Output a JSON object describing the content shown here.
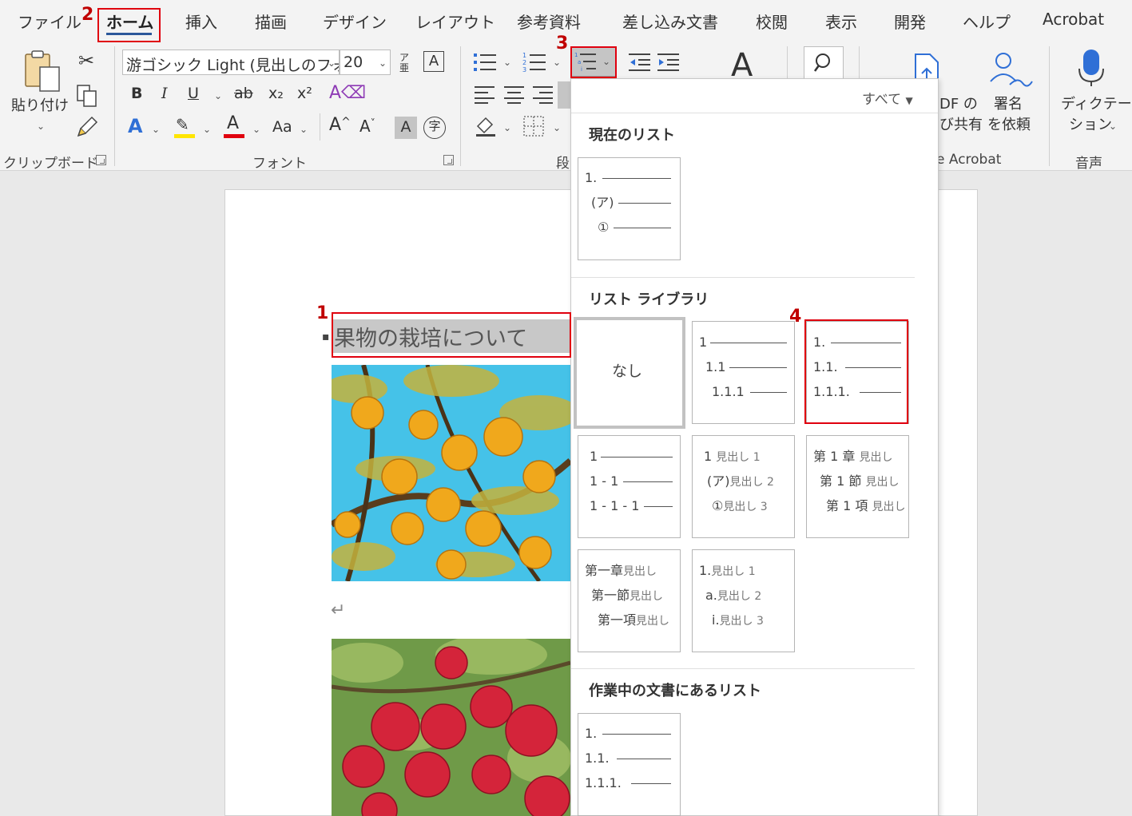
{
  "menu": {
    "items": [
      "ファイル",
      "ホーム",
      "挿入",
      "描画",
      "デザイン",
      "レイアウト",
      "参考資料",
      "差し込み文書",
      "校閲",
      "表示",
      "開発",
      "ヘルプ",
      "Acrobat"
    ],
    "active": "ホーム"
  },
  "ribbon": {
    "clipboard": {
      "paste_label": "貼り付け",
      "group_label": "クリップボード"
    },
    "font": {
      "font_name": "游ゴシック Light (見出しのフォ",
      "font_size": "20",
      "bold": "B",
      "italic": "I",
      "underline": "U",
      "strike": "ab",
      "subscript": "x₂",
      "superscript": "x²",
      "font_color_glyph": "A",
      "case_label": "Aa",
      "grow": "A^",
      "shrink": "A˅",
      "group_label": "フォント"
    },
    "paragraph": {
      "group_label_partial": "段"
    },
    "acrobat": {
      "share_label_1": "DF の",
      "share_label_2": "び共有",
      "sign_label_1": "署名",
      "sign_label_2": "を依頼",
      "group_label_partial": "e Acrobat"
    },
    "voice": {
      "dictate_label_1": "ディクテー",
      "dictate_label_2": "ション",
      "group_label": "音声"
    }
  },
  "document": {
    "heading": "果物の栽培について",
    "paragraph_mark": "↵"
  },
  "dropdown": {
    "filter_label": "すべて",
    "sections": {
      "current": "現在のリスト",
      "library": "リスト ライブラリ",
      "in_document": "作業中の文書にあるリスト"
    },
    "current_list": [
      "1.",
      "(ア)",
      "①"
    ],
    "none_label": "なし",
    "library_lists": [
      [
        "1",
        "1.1",
        "1.1.1"
      ],
      [
        "1.",
        "1.1.",
        "1.1.1."
      ],
      [
        "1",
        "1 - 1",
        "1 - 1 - 1"
      ],
      [
        [
          "1",
          "見出し 1"
        ],
        [
          "(ア)",
          "見出し 2"
        ],
        [
          "①",
          "見出し 3"
        ]
      ],
      [
        [
          "第 1 章",
          "見出し"
        ],
        [
          "第 1 節",
          "見出し"
        ],
        [
          "第 1 項",
          "見出し"
        ]
      ],
      [
        [
          "第一章",
          "見出し"
        ],
        [
          "第一節",
          "見出し"
        ],
        [
          "第一項",
          "見出し"
        ]
      ],
      [
        [
          "1.",
          "見出し 1"
        ],
        [
          "a.",
          "見出し 2"
        ],
        [
          "i.",
          "見出し 3"
        ]
      ]
    ],
    "document_list": [
      "1.",
      "1.1.",
      "1.1.1."
    ]
  },
  "annotations": [
    "1",
    "2",
    "3",
    "4"
  ],
  "colors": {
    "accent": "#2b579a",
    "annotation_red": "#e0000e",
    "highlight": "#c8c8c8"
  }
}
